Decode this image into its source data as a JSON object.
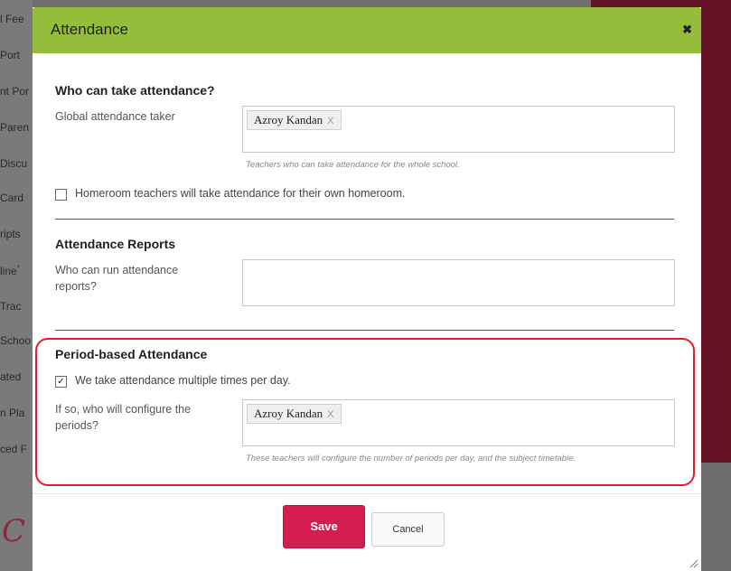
{
  "background": {
    "sidebar_items": [
      "l Fee",
      "Port",
      "nt Por",
      "Paren",
      "Discu",
      "Card",
      "ripts",
      "line",
      "Trac",
      "Schoo",
      "ated",
      "n Pla",
      "ced F"
    ],
    "required_mark": "*"
  },
  "modal": {
    "title": "Attendance",
    "close_icon": "✖",
    "who_can_take": {
      "title": "Who can take attendance?",
      "global_label": "Global attendance taker",
      "global_tags": [
        "Azroy Kandan"
      ],
      "help": "Teachers who can take attendance for the whole school.",
      "homeroom_checked": false,
      "homeroom_label": "Homeroom teachers will take attendance for their own homeroom."
    },
    "reports": {
      "title": "Attendance Reports",
      "run_label": "Who can run attendance reports?",
      "run_tags": []
    },
    "period_based": {
      "title": "Period-based Attendance",
      "multiple_checked": true,
      "multiple_label": "We take attendance multiple times per day.",
      "configure_label": "If so, who will configure the periods?",
      "configure_tags": [
        "Azroy Kandan"
      ],
      "help": "These teachers will configure the number of periods per day, and the subject timetable."
    },
    "buttons": {
      "save": "Save",
      "cancel": "Cancel"
    }
  },
  "colors": {
    "header": "#94bd3c",
    "save": "#d31d50",
    "highlight": "#e31b2c"
  }
}
